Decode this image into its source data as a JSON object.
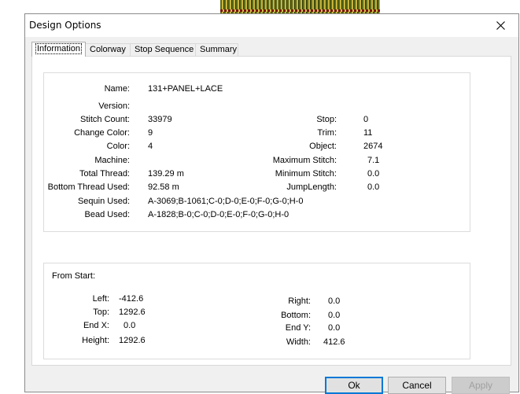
{
  "dialog": {
    "title": "Design Options",
    "close_glyph": "✕"
  },
  "tabs": [
    "Information",
    "Colorway",
    "Stop Sequence",
    "Summary"
  ],
  "info": {
    "name_label": "Name:",
    "name_value": "131+PANEL+LACE",
    "version_label": "Version:",
    "version_value": "",
    "stitch_count_label": "Stitch Count:",
    "stitch_count_value": "33979",
    "change_color_label": "Change Color:",
    "change_color_value": "9",
    "color_label": "Color:",
    "color_value": "4",
    "machine_label": "Machine:",
    "machine_value": "",
    "total_thread_label": "Total Thread:",
    "total_thread_value": "139.29 m",
    "bottom_thread_label": "Bottom Thread Used:",
    "bottom_thread_value": "92.58 m",
    "sequin_label": "Sequin Used:",
    "sequin_value": "A-3069;B-1061;C-0;D-0;E-0;F-0;G-0;H-0",
    "bead_label": "Bead Used:",
    "bead_value": "A-1828;B-0;C-0;D-0;E-0;F-0;G-0;H-0",
    "stop_label": "Stop:",
    "stop_value": "0",
    "trim_label": "Trim:",
    "trim_value": "11",
    "object_label": "Object:",
    "object_value": "2674",
    "max_stitch_label": "Maximum Stitch:",
    "max_stitch_value": "7.1",
    "min_stitch_label": "Minimum Stitch:",
    "min_stitch_value": "0.0",
    "jump_length_label": "JumpLength:",
    "jump_length_value": "0.0"
  },
  "from_start": {
    "title": "From Start:",
    "left_label": "Left:",
    "left_value": "-412.6",
    "top_label": "Top:",
    "top_value": "1292.6",
    "endx_label": "End X:",
    "endx_value": "0.0",
    "height_label": "Height:",
    "height_value": "1292.6",
    "right_label": "Right:",
    "right_value": "0.0",
    "bottom_label": "Bottom:",
    "bottom_value": "0.0",
    "endy_label": "End Y:",
    "endy_value": "0.0",
    "width_label": "Width:",
    "width_value": "412.6"
  },
  "buttons": {
    "ok": "Ok",
    "cancel": "Cancel",
    "apply": "Apply"
  }
}
